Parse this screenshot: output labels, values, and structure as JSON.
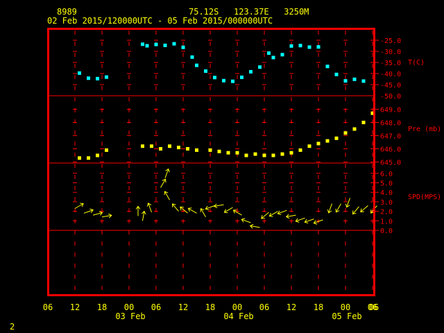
{
  "header": {
    "station": "8989",
    "location": "75.12S   123.37E   3250M",
    "period": "02 Feb 2015/120000UTC - 05 Feb 2015/000000UTC"
  },
  "page_number": "2",
  "colors": {
    "frame": "#ff0000",
    "grid": "#ff0000",
    "axis_text": "#ffff00",
    "panel_text": "#ff0000",
    "temp": "#00ffff",
    "pressure": "#ffff00",
    "wind": "#ffff00"
  },
  "chart_data": [
    {
      "type": "scatter",
      "panel": "temperature",
      "ylabel": "T(C)",
      "ylim": [
        -50,
        -22
      ],
      "yticks": [
        -25.0,
        -30.0,
        -35.0,
        -40.0,
        -45.0,
        -50.0
      ],
      "ytick_labels": [
        "-25.0",
        "-30.0",
        "-35.0",
        "-40.0",
        "-45.0"
      ],
      "x_hours": [
        13,
        15,
        17,
        19,
        27,
        28,
        30,
        32,
        34,
        36,
        38,
        39,
        41,
        43,
        45,
        47,
        49,
        51,
        53,
        55,
        56,
        58,
        60,
        62,
        64,
        66,
        68,
        70,
        72,
        74,
        76
      ],
      "values": [
        -39.8,
        -42.1,
        -42.3,
        -41.6,
        -26.8,
        -27.5,
        -26.9,
        -27.3,
        -26.6,
        -28.2,
        -32.6,
        -36.3,
        -38.9,
        -41.8,
        -43.2,
        -43.5,
        -41.7,
        -39.2,
        -37.1,
        -30.8,
        -32.8,
        -31.5,
        -27.6,
        -27.4,
        -28.1,
        -28.0,
        -36.8,
        -40.4,
        -43.3,
        -42.6,
        -43.4
      ]
    },
    {
      "type": "scatter",
      "panel": "pressure",
      "ylabel": "Pre (mb)",
      "ylim": [
        644.8,
        649.5
      ],
      "yticks": [
        645.0,
        646.0,
        647.0,
        648.0,
        649.0
      ],
      "ytick_labels": [
        "645.0",
        "646.0",
        "647.0",
        "648.0",
        "649.0"
      ],
      "x_hours": [
        13,
        15,
        17,
        19,
        27,
        29,
        31,
        33,
        35,
        37,
        39,
        42,
        44,
        46,
        48,
        50,
        52,
        54,
        56,
        58,
        60,
        62,
        64,
        66,
        68,
        70,
        72,
        74,
        76,
        78
      ],
      "values": [
        645.3,
        645.3,
        645.5,
        645.9,
        646.2,
        646.2,
        646.0,
        646.2,
        646.1,
        646.0,
        645.9,
        645.9,
        645.8,
        645.7,
        645.7,
        645.5,
        645.6,
        645.5,
        645.5,
        645.6,
        645.7,
        645.9,
        646.2,
        646.4,
        646.6,
        646.8,
        647.2,
        647.5,
        648.0,
        648.7
      ]
    },
    {
      "type": "scatter",
      "panel": "wind_speed",
      "ylabel": "SPD(MPS)",
      "ylim": [
        0,
        6.5
      ],
      "yticks": [
        0.0,
        1.0,
        2.0,
        3.0,
        4.0,
        5.0,
        6.0
      ],
      "ytick_labels": [
        "0.0",
        "1.0",
        "2.0",
        "3.0",
        "4.0",
        "5.0",
        "6.0"
      ],
      "x_hours": [
        12,
        14,
        16,
        18,
        26,
        27,
        29,
        31,
        32,
        33,
        35,
        37,
        39,
        41,
        43,
        45,
        47,
        49,
        51,
        53,
        55,
        57,
        59,
        61,
        63,
        65,
        67,
        69,
        71,
        73,
        75,
        77,
        79
      ],
      "values": [
        2.3,
        1.8,
        1.6,
        1.4,
        1.5,
        1.0,
        1.9,
        4.5,
        5.5,
        3.2,
        2.0,
        1.8,
        1.8,
        1.4,
        2.6,
        2.7,
        2.4,
        1.6,
        0.8,
        0.3,
        1.9,
        2.0,
        2.1,
        1.6,
        1.3,
        1.2,
        1.1,
        2.8,
        2.8,
        3.4,
        2.5,
        2.6,
        2.6
      ],
      "direction_deg": [
        60,
        70,
        75,
        80,
        0,
        10,
        340,
        30,
        20,
        330,
        320,
        310,
        300,
        330,
        250,
        260,
        240,
        300,
        290,
        280,
        230,
        240,
        250,
        260,
        250,
        250,
        250,
        200,
        210,
        200,
        220,
        230,
        220
      ]
    }
  ],
  "x_axis": {
    "hour_ticks": [
      6,
      12,
      18,
      24,
      30,
      36,
      42,
      48,
      54,
      60,
      66,
      72,
      78,
      84
    ],
    "hour_labels": [
      "06",
      "12",
      "18",
      "00",
      "06",
      "12",
      "18",
      "00",
      "06",
      "12",
      "18",
      "00",
      "06"
    ],
    "date_labels": [
      {
        "hour": 24,
        "label": "03 Feb"
      },
      {
        "hour": 48,
        "label": "04 Feb"
      },
      {
        "hour": 72,
        "label": "05 Feb"
      }
    ]
  }
}
